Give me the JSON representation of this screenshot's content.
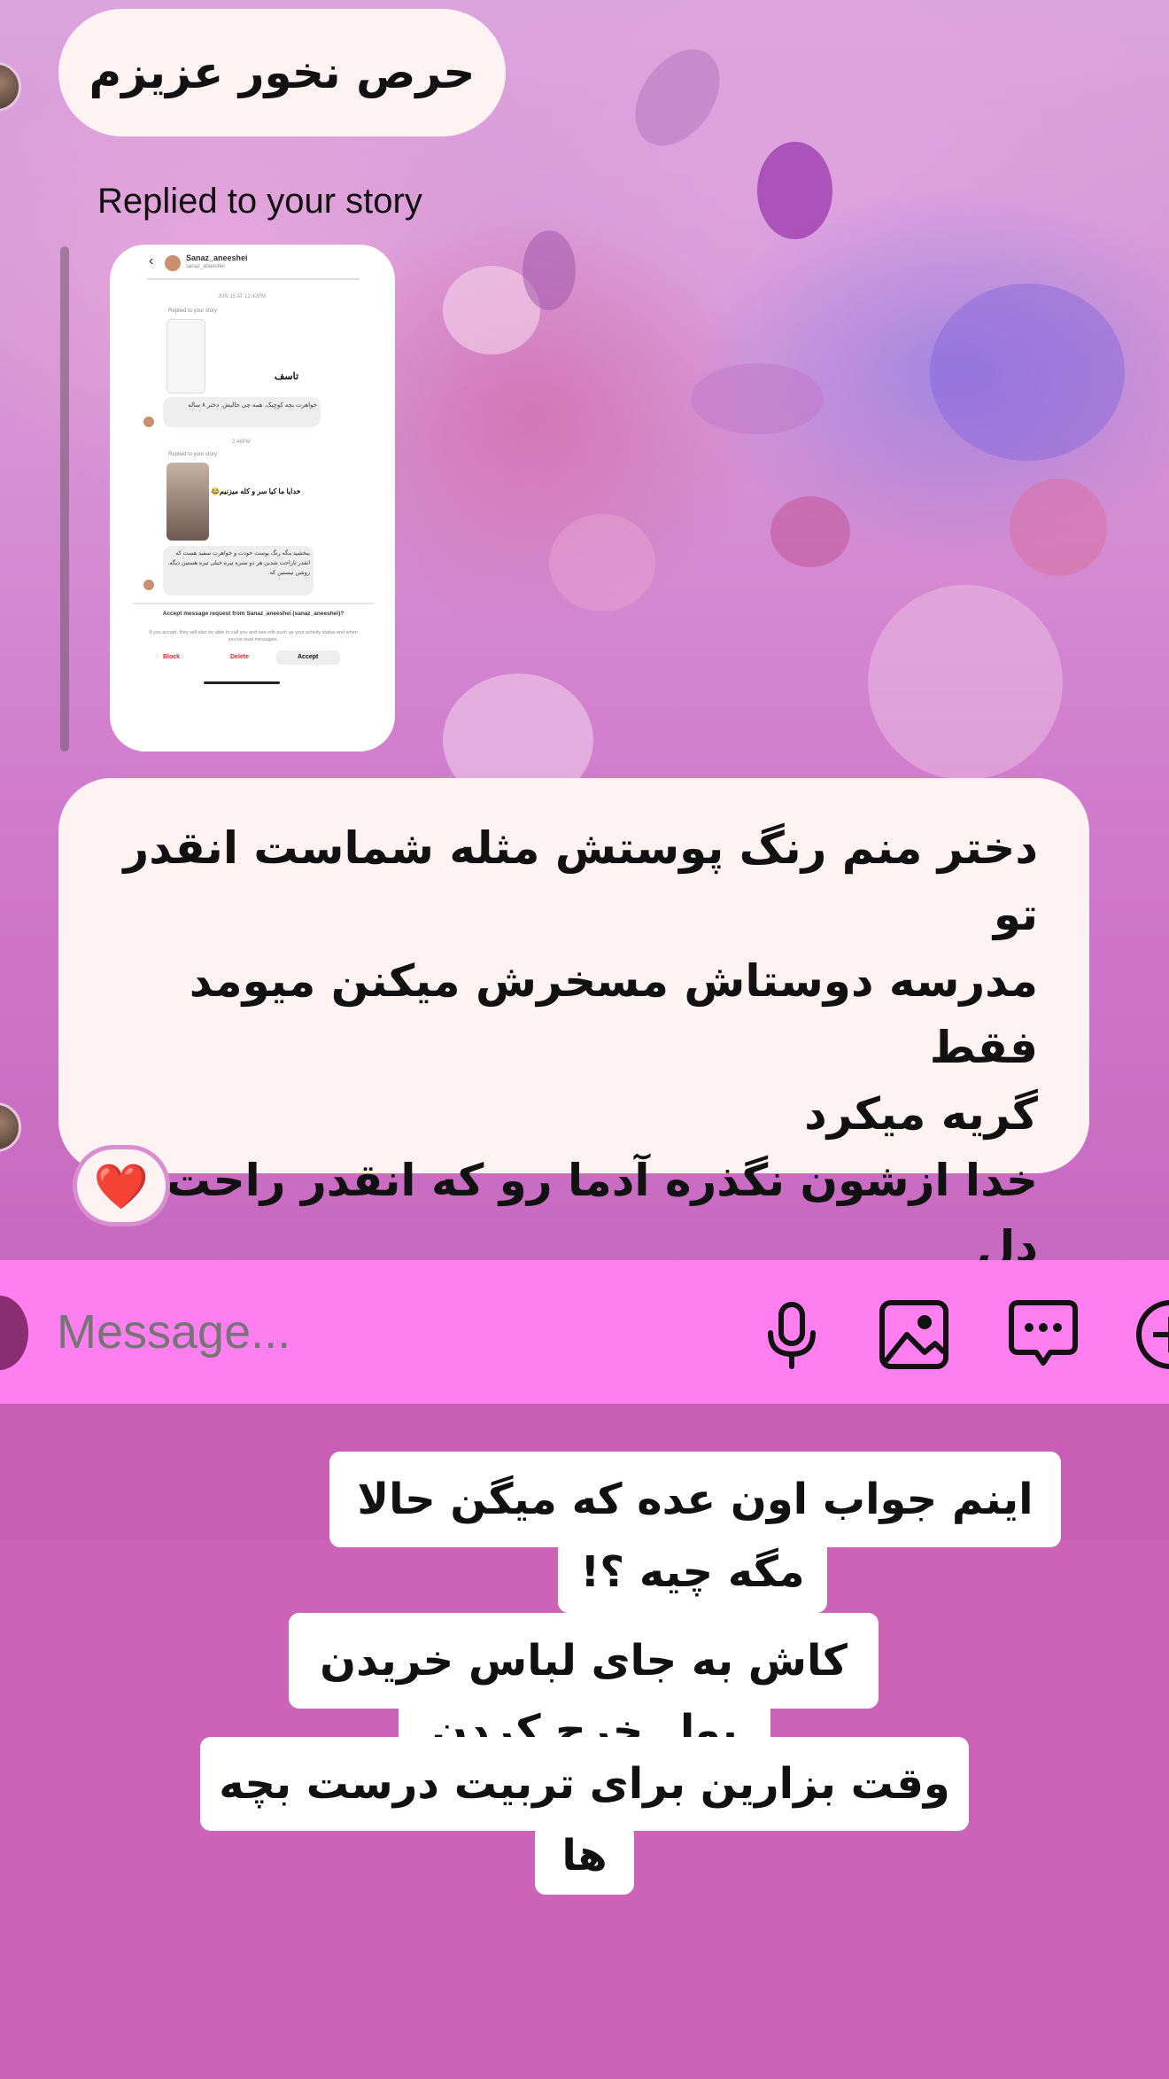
{
  "chat": {
    "message_1": "حرص نخور عزیزم",
    "reply_label": "Replied to your story",
    "story_preview": {
      "username": "Sanaz_aneeshei",
      "handle": "sanaz_aneeshei",
      "timestamp_1": "JUN 15 AT 12:42PM",
      "replied_label_1": "Replied to your story",
      "sticker_1": "تاسف",
      "reply_1": "خواهرت بچه کوچیک. همه چی حالیش. دختر ۸ ساله",
      "timestamp_2": "2:46PM",
      "replied_label_2": "Replied to your story",
      "sticker_2": "خدایا ما کیا سر و کله میزنیم😂",
      "reply_2": "ببخشید مگه رنگ پوست خودت و خواهرت سفید هست که انقدر ناراحت شدین هر دو سبزه تیره خیلی تیره هستین دیگه. روشن نیستین که.",
      "accept_title": "Accept message request from Sanaz_aneeshei (sanaz_aneeshei)?",
      "accept_body": "If you accept, they will also be able to call you and see info such as your activity status and when you've read messages.",
      "block": "Block",
      "delete": "Delete",
      "accept": "Accept"
    },
    "message_2": "دختر منم رنگ پوستش مثله شماست انقدر تو\nمدرسه دوستاش مسخرش میکنن میومد فقط\nگریه میکرد\nخدا ازشون نگذره آدما رو که انقدر راحت دل\nمیشکونن",
    "reaction": "❤️"
  },
  "composer": {
    "placeholder": "Message...",
    "icons": [
      "microphone-icon",
      "image-icon",
      "sticker-chat-icon",
      "plus-icon"
    ]
  },
  "overlay_text": {
    "line_1": "اینم جواب اون عده که میگن حالا",
    "line_2": "مگه چیه ؟!",
    "line_3": "کاش به جای لباس خریدن",
    "line_4": "پول خرج کردن",
    "line_5": "وقت بزارین برای تربیت درست بچه",
    "line_6": "ها"
  },
  "colors": {
    "composer_bg": "#ff7ff0",
    "placeholder": "#9a3bd0",
    "bubble_bg": "#fff2f3",
    "lower_bg": "#cc63b6",
    "heart": "#e0242f"
  }
}
